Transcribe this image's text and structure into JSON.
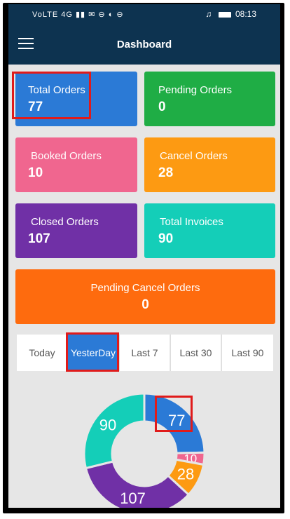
{
  "status": {
    "left_icons": "VoLTE 4G ▮▮ ✉ ⊖ ◐ ⊖",
    "headphone_icon": "headphones-icon",
    "time": "08:13"
  },
  "appbar": {
    "title": "Dashboard",
    "menu_icon": "menu-icon"
  },
  "cards": {
    "total_orders": {
      "label": "Total Orders",
      "value": "77",
      "color": "#2b7ad6"
    },
    "pending_orders": {
      "label": "Pending Orders",
      "value": "0",
      "color": "#1fad45"
    },
    "booked_orders": {
      "label": "Booked Orders",
      "value": "10",
      "color": "#f0668f"
    },
    "cancel_orders": {
      "label": "Cancel Orders",
      "value": "28",
      "color": "#fd9a12"
    },
    "closed_orders": {
      "label": "Closed Orders",
      "value": "107",
      "color": "#7030a6"
    },
    "total_invoices": {
      "label": "Total Invoices",
      "value": "90",
      "color": "#14ceb8"
    },
    "pending_cancel_orders": {
      "label": "Pending Cancel Orders",
      "value": "0",
      "color": "#fe6b0e"
    }
  },
  "tabs": [
    {
      "label": "Today"
    },
    {
      "label": "YesterDay",
      "active": true
    },
    {
      "label": "Last 7"
    },
    {
      "label": "Last 30"
    },
    {
      "label": "Last 90"
    }
  ],
  "chart_data": {
    "type": "pie",
    "variant": "donut",
    "slices": [
      {
        "label": "77",
        "value": 77,
        "color": "#2b7ad6"
      },
      {
        "label": "10",
        "value": 10,
        "color": "#f0668f"
      },
      {
        "label": "28",
        "value": 28,
        "color": "#fd9a12"
      },
      {
        "label": "107",
        "value": 107,
        "color": "#7030a6"
      },
      {
        "label": "90",
        "value": 90,
        "color": "#14ceb8"
      }
    ]
  },
  "colors": {
    "appbar": "#0d3350",
    "highlight": "#e01b1b",
    "background": "#e6e6e6"
  }
}
